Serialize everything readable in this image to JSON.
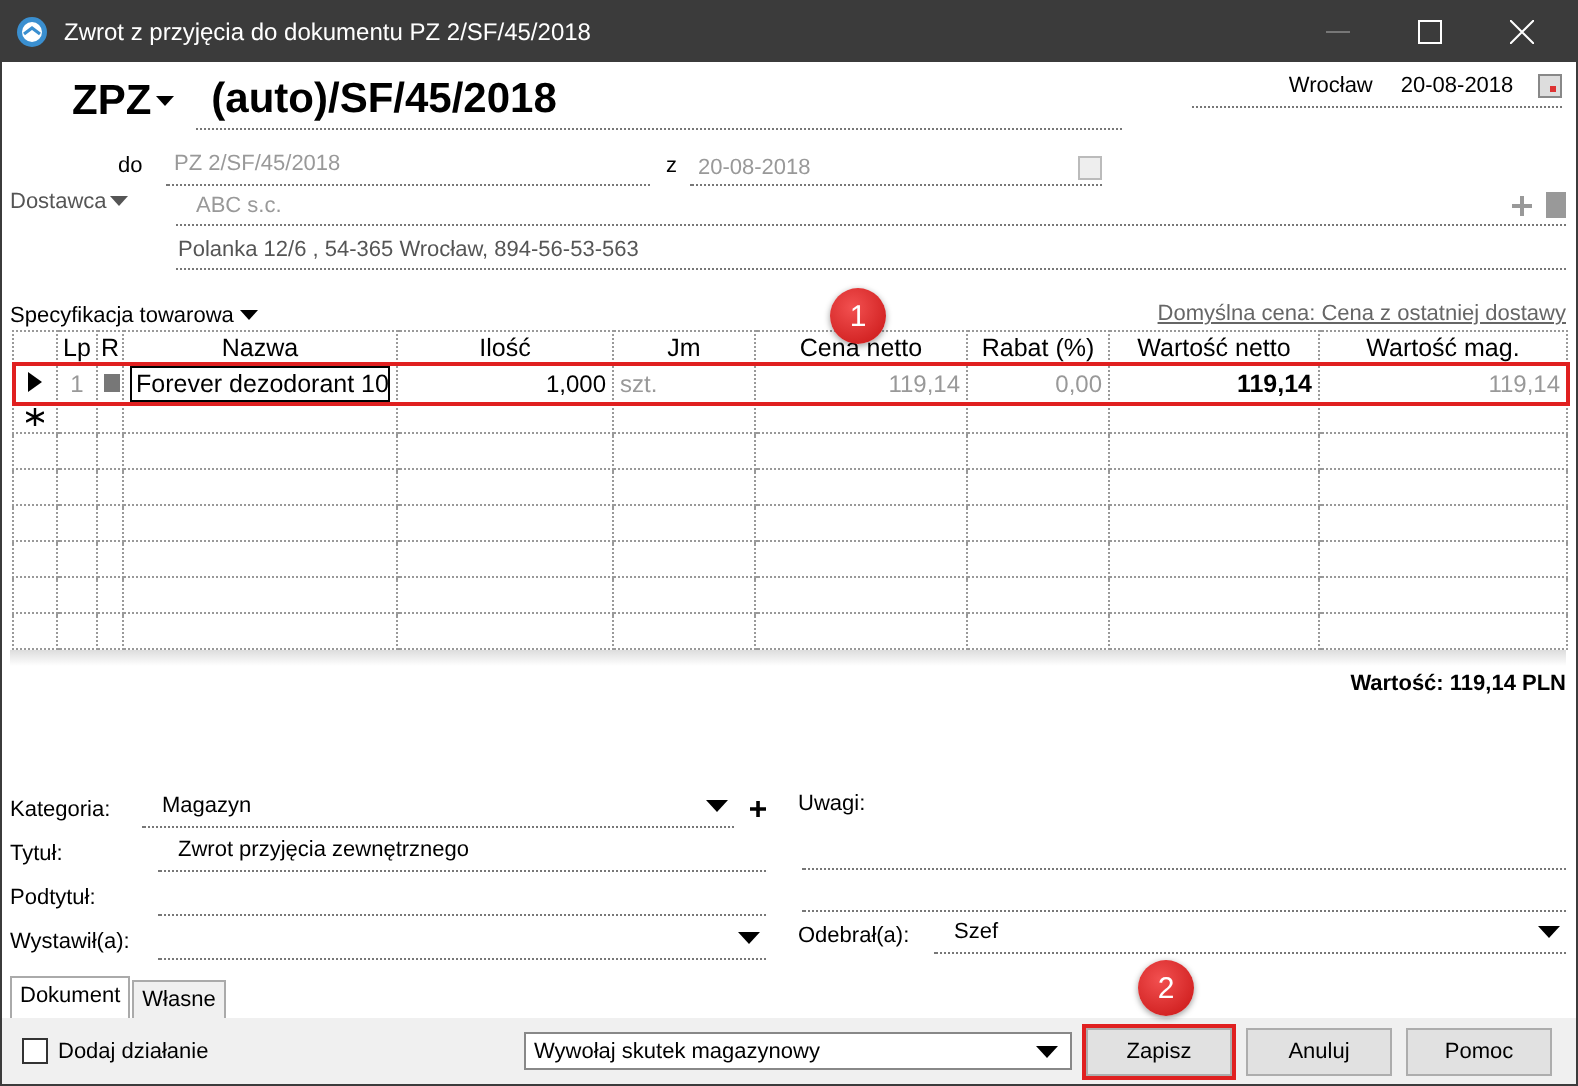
{
  "window": {
    "title": "Zwrot z przyjęcia do dokumentu PZ 2/SF/45/2018"
  },
  "header": {
    "doc_type": "ZPZ",
    "number": "(auto)/SF/45/2018",
    "place": "Wrocław",
    "date": "20-08-2018",
    "do_label": "do",
    "do_value": "PZ 2/SF/45/2018",
    "z_label": "z",
    "z_date": "20-08-2018",
    "supplier_label": "Dostawca",
    "supplier_name": "ABC s.c.",
    "supplier_address": "Polanka  12/6 , 54-365 Wrocław, 894-56-53-563"
  },
  "spec": {
    "label": "Specyfikacja towarowa",
    "default_price": "Domyślna cena: Cena z ostatniej dostawy"
  },
  "table": {
    "columns": [
      "Lp",
      "R",
      "Nazwa",
      "Ilość",
      "Jm",
      "Cena netto",
      "Rabat (%)",
      "Wartość netto",
      "Wartość mag."
    ],
    "rows": [
      {
        "lp": "1",
        "name": "Forever dezodorant 10",
        "qty": "1,000",
        "unit": "szt.",
        "price": "119,14",
        "discount": "0,00",
        "net": "119,14",
        "mag": "119,14",
        "selected": true,
        "highlighted": true
      }
    ]
  },
  "total": "Wartość: 119,14 PLN",
  "form_left": [
    {
      "label": "Kategoria:",
      "value": "Magazyn",
      "kind": "dropdown_add"
    },
    {
      "label": "Tytuł:",
      "value": "Zwrot przyjęcia zewnętrznego",
      "kind": "text"
    },
    {
      "label": "Podtytuł:",
      "kind": "text"
    },
    {
      "label": "Wystawił(a):",
      "kind": "dropdown"
    }
  ],
  "form_right": {
    "notes_label": "Uwagi:",
    "receiver_label": "Odebrał(a):",
    "receiver": "Szef"
  },
  "tabs": [
    {
      "label": "Dokument",
      "selected": true
    },
    {
      "label": "Własne",
      "selected": false
    }
  ],
  "footer": {
    "checkbox": {
      "label": "Dodaj działanie",
      "checked": false
    },
    "action": "Wywołaj skutek magazynowy",
    "buttons": [
      {
        "label": "Zapisz",
        "highlighted": true
      },
      {
        "label": "Anuluj",
        "highlighted": false
      },
      {
        "label": "Pomoc",
        "highlighted": false
      }
    ]
  },
  "annotations": [
    "1",
    "2"
  ]
}
